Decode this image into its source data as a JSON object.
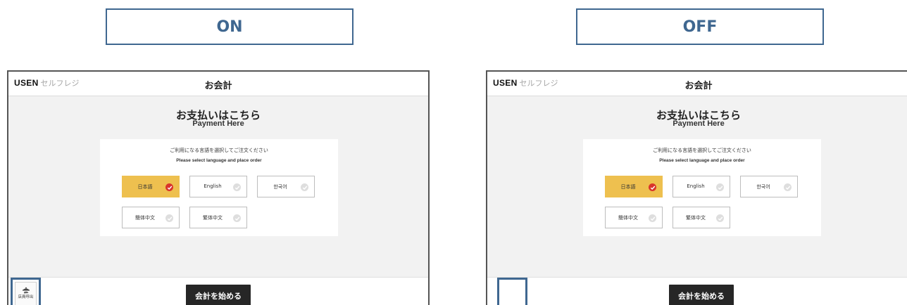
{
  "panels": [
    {
      "state_label": "ON",
      "app": {
        "brand_main": "USEN",
        "brand_sub": "セルフレジ",
        "title": "お会計"
      },
      "payment_title": "お支払いはこちら",
      "payment_subtitle": "Payment Here",
      "language_prompt_ja": "ご利用になる言語を選択してご注文ください",
      "language_prompt_en": "Please select language and place order",
      "languages": [
        {
          "label": "日本語",
          "selected": true
        },
        {
          "label": "English",
          "selected": false
        },
        {
          "label": "한국어",
          "selected": false
        },
        {
          "label": "簡体中文",
          "selected": false
        },
        {
          "label": "繁体中文",
          "selected": false
        }
      ],
      "start_button_label": "会計を始める",
      "staff_call": {
        "visible": true,
        "label": "店員呼出",
        "icon": "bell-hand-icon"
      }
    },
    {
      "state_label": "OFF",
      "app": {
        "brand_main": "USEN",
        "brand_sub": "セルフレジ",
        "title": "お会計"
      },
      "payment_title": "お支払いはこちら",
      "payment_subtitle": "Payment Here",
      "language_prompt_ja": "ご利用になる言語を選択してご注文ください",
      "language_prompt_en": "Please select language and place order",
      "languages": [
        {
          "label": "日本語",
          "selected": true
        },
        {
          "label": "English",
          "selected": false
        },
        {
          "label": "한국어",
          "selected": false
        },
        {
          "label": "簡体中文",
          "selected": false
        },
        {
          "label": "繁体中文",
          "selected": false
        }
      ],
      "start_button_label": "会計を始める",
      "staff_call": {
        "visible": false,
        "label": "",
        "icon": ""
      }
    }
  ],
  "colors": {
    "accent_blue": "#3f6790",
    "selected_language": "#eec04f",
    "check_red": "#d9342b",
    "start_button": "#262626",
    "screen_background": "#f2f2f2"
  }
}
